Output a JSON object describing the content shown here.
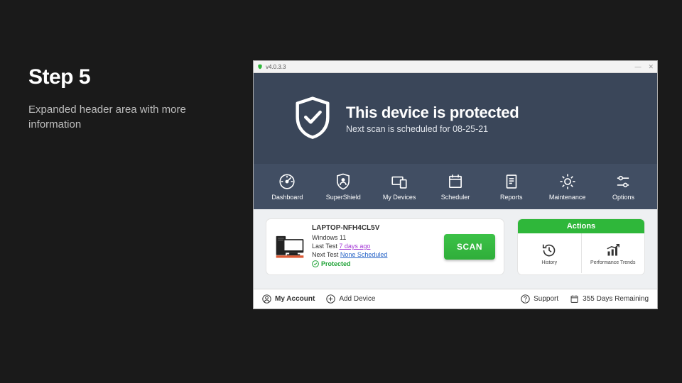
{
  "slide": {
    "step_title": "Step 5",
    "step_desc": "Expanded header area with more information"
  },
  "titlebar": {
    "version": "v4.0.3.3",
    "minimize": "—",
    "close": "✕"
  },
  "hero": {
    "title": "This device is protected",
    "subtitle": "Next scan is scheduled for 08-25-21"
  },
  "nav": [
    {
      "label": "Dashboard"
    },
    {
      "label": "SuperShield"
    },
    {
      "label": "My Devices"
    },
    {
      "label": "Scheduler"
    },
    {
      "label": "Reports"
    },
    {
      "label": "Maintenance"
    },
    {
      "label": "Options"
    }
  ],
  "device": {
    "name": "LAPTOP-NFH4CL5V",
    "os": "Windows 11",
    "last_test_label": "Last Test",
    "last_test_value": "7 days ago",
    "next_test_label": "Next Test",
    "next_test_value": "None Scheduled",
    "protected_label": "Protected",
    "scan_label": "SCAN"
  },
  "actions": {
    "header": "Actions",
    "history": "History",
    "trends": "Performance Trends"
  },
  "footer": {
    "my_account": "My Account",
    "add_device": "Add Device",
    "support": "Support",
    "days_remaining": "355 Days Remaining"
  }
}
